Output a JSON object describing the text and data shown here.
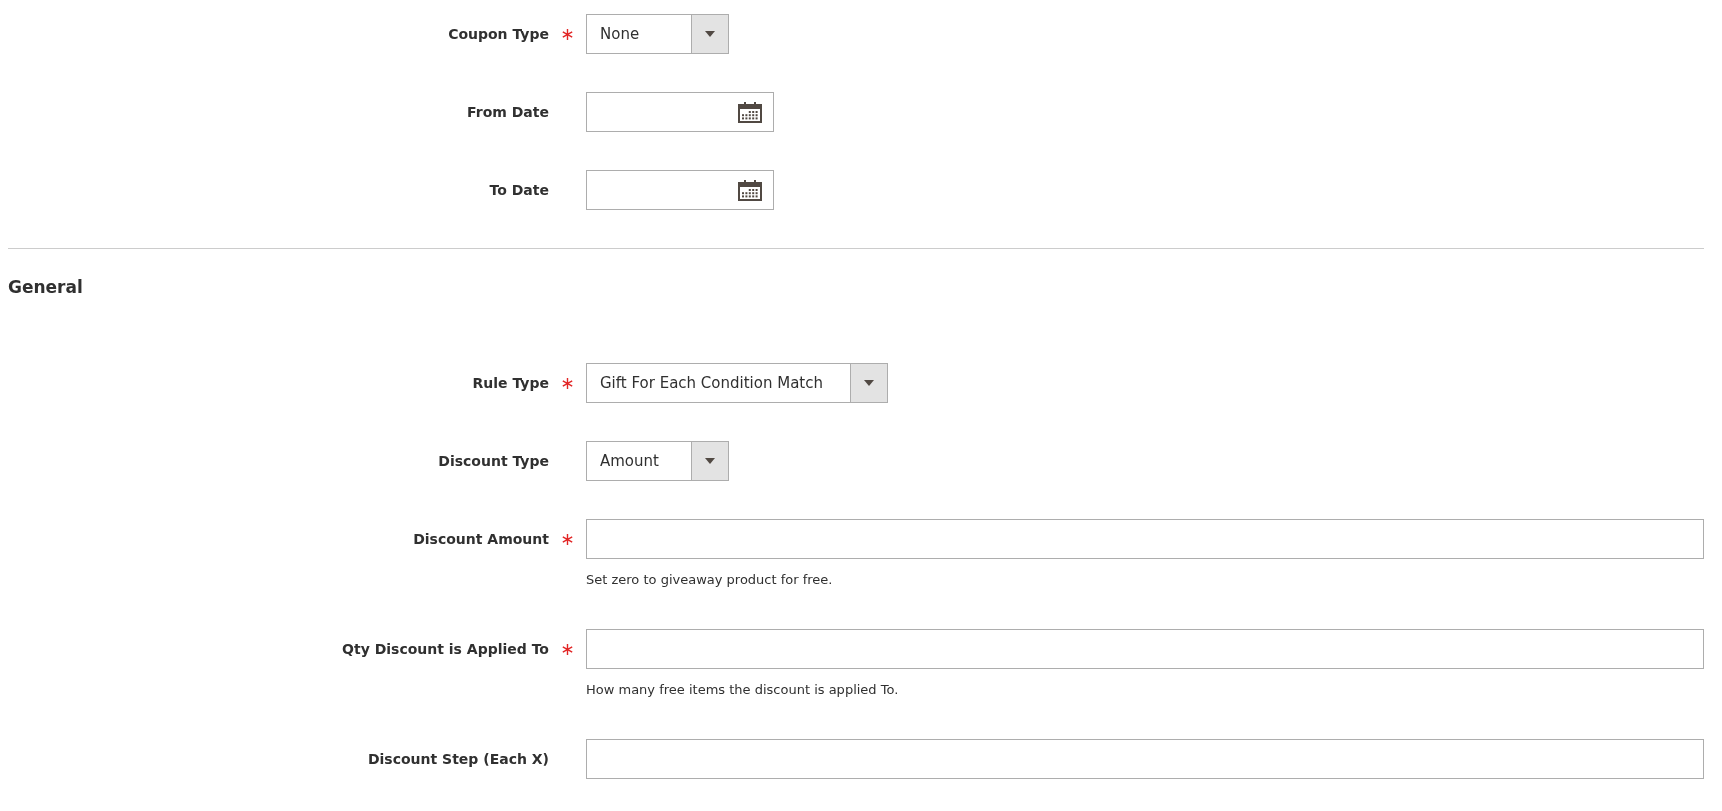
{
  "schedule_fields": [
    {
      "kind": "select",
      "label": "Coupon Type",
      "required": true,
      "value": "None"
    },
    {
      "kind": "date",
      "label": "From Date",
      "required": false
    },
    {
      "kind": "date",
      "label": "To Date",
      "required": false
    }
  ],
  "general": {
    "title": "General",
    "fields": [
      {
        "kind": "select",
        "label": "Rule Type",
        "required": true,
        "value": "Gift For Each Condition Match"
      },
      {
        "kind": "select",
        "label": "Discount Type",
        "required": false,
        "value": "Amount"
      },
      {
        "kind": "text",
        "label": "Discount Amount",
        "required": true,
        "note": "Set zero to giveaway product for free."
      },
      {
        "kind": "text",
        "label": "Qty Discount is Applied To",
        "required": true,
        "note": "How many free items the discount is applied To."
      },
      {
        "kind": "text",
        "label": "Discount Step (Each X)",
        "required": false
      }
    ]
  }
}
